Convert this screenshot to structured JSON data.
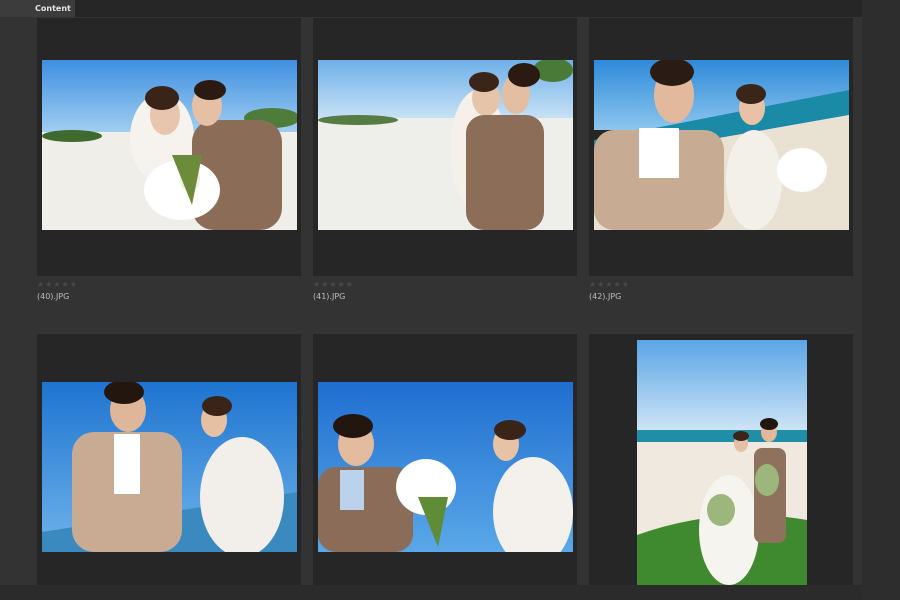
{
  "panel": {
    "tab_label": "Content"
  },
  "items": [
    {
      "filename": "(40).JPG",
      "rating": "★★★★★",
      "scene": "beach couple with lily bouquet"
    },
    {
      "filename": "(41).JPG",
      "rating": "★★★★★",
      "scene": "beach couple embracing"
    },
    {
      "filename": "(42).JPG",
      "rating": "★★★★★",
      "scene": "couple walking by sea"
    },
    {
      "filename": "",
      "rating": "",
      "scene": "couple against blue sky"
    },
    {
      "filename": "",
      "rating": "",
      "scene": "groom offering lilies"
    },
    {
      "filename": "",
      "rating": "",
      "scene": "portrait couple on grass by beach"
    }
  ],
  "colors": {
    "background": "#333333",
    "cell": "#262626",
    "sky": "#3f8fd8",
    "sand": "#f3efe6",
    "suit": "#8b6e5a",
    "grass": "#3f8a2f"
  }
}
